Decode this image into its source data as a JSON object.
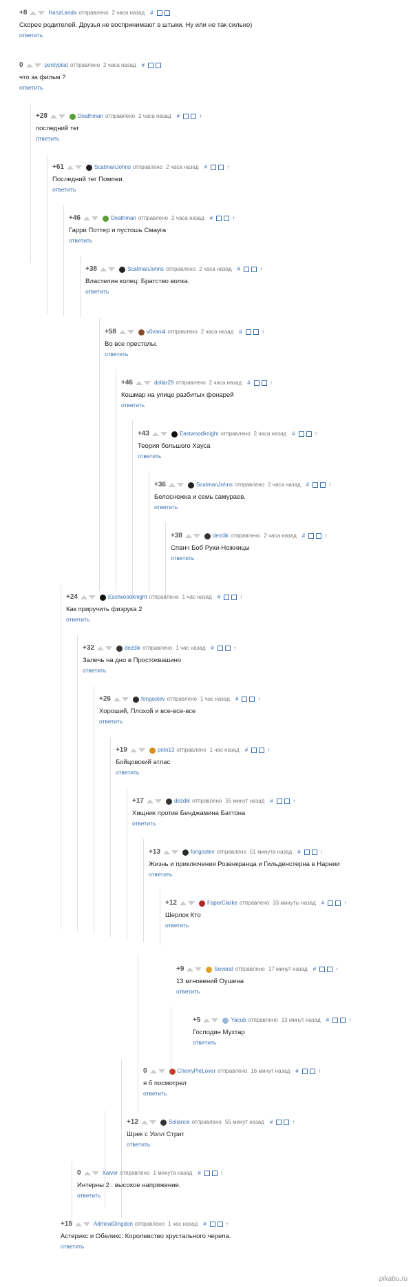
{
  "labels": {
    "sent": "отправлено",
    "reply": "ответить"
  },
  "colors": {
    "link": "#3a6fb0",
    "score": "#555555",
    "thread_line": "#e0e0e0"
  },
  "comments": [
    {
      "score": "+8",
      "user": "HanzLanda",
      "time": "2 часа назад",
      "text": "Скорее родителей. Друзья не воспринимают в штыки. Ну или не так сильно)",
      "avatar": null
    },
    {
      "score": "0",
      "user": "pontypilat",
      "time": "2 часа назад",
      "text": "что за фильм ?",
      "avatar": null
    },
    {
      "score": "+28",
      "user": "Deathman",
      "time": "2 часа назад",
      "text": "последний тег",
      "avatar": "#5a9e3a"
    },
    {
      "score": "+61",
      "user": "ScatmanJohns",
      "time": "2 часа назад",
      "text": "Последний тег Помпеи.",
      "avatar": "#222222"
    },
    {
      "score": "+46",
      "user": "Deathman",
      "time": "2 часа назад",
      "text": "Гарри Поттер и пустошь Смауга",
      "avatar": "#5a9e3a"
    },
    {
      "score": "+38",
      "user": "ScatmanJohns",
      "time": "2 часа назад",
      "text": "Властелин колец: Братство волка.",
      "avatar": "#222222"
    },
    {
      "score": "+58",
      "user": "v0vani4",
      "time": "2 часа назад",
      "text": "Во все престолы.",
      "avatar": "#8a4b2a"
    },
    {
      "score": "+46",
      "user": "dollar29",
      "time": "2 часа назад",
      "text": "Кошмар на улице разбитых фонарей",
      "avatar": null
    },
    {
      "score": "+43",
      "user": "Eastwoodknight",
      "time": "2 часа назад",
      "text": "Теория большого Хауса",
      "avatar": "#111111"
    },
    {
      "score": "+36",
      "user": "ScatmanJohns",
      "time": "2 часа назад",
      "text": "Белоснежка и семь самураев.",
      "avatar": "#222222"
    },
    {
      "score": "+38",
      "user": "dezdik",
      "time": "2 часа назад",
      "text": "Спанч Боб Руки-Ножницы",
      "avatar": "#333333"
    },
    {
      "score": "+24",
      "user": "Eastwoodknight",
      "time": "1 час назад",
      "text": "Как приручить физрука 2",
      "avatar": "#111111"
    },
    {
      "score": "+32",
      "user": "dezdik",
      "time": "1 час назад",
      "text": "Залечь на дно в Простоквашино",
      "avatar": "#333333"
    },
    {
      "score": "+26",
      "user": "fongostev",
      "time": "1 час назад",
      "text": "Хороший, Плохой и все-все-все",
      "avatar": "#2a2a2a"
    },
    {
      "score": "+19",
      "user": "pntn13",
      "time": "1 час назад",
      "text": "Бойцовский атлас",
      "avatar": "#d98c1a"
    },
    {
      "score": "+17",
      "user": "dezdik",
      "time": "55 минут назад",
      "text": "Хищник против Бенджамина Баттона",
      "avatar": "#333333"
    },
    {
      "score": "+13",
      "user": "fongostev",
      "time": "51 минута назад",
      "text": "Жизнь и приключения Розенкранца и Гильденстерна в Нарнии",
      "avatar": "#2a2a2a"
    },
    {
      "score": "+12",
      "user": "FaperClarke",
      "time": "33 минуты назад",
      "text": "Шерлок Кто",
      "avatar": "#b3262a"
    },
    {
      "score": "+9",
      "user": "Several",
      "time": "17 минут назад",
      "text": "13 мгновений Оушена",
      "avatar": "#e0a020"
    },
    {
      "score": "+5",
      "user": "Yacub",
      "time": "13 минут назад",
      "text": "Господин Мухтар",
      "avatar": "#9ab8d8"
    },
    {
      "score": "0",
      "user": "CherryPieLover",
      "time": "16 минут назад",
      "text": "я б посмотрел",
      "avatar": "#c2402a"
    },
    {
      "score": "+12",
      "user": "Soliance",
      "time": "55 минут назад",
      "text": "Шрек с Уолл Стрит",
      "avatar": "#333333"
    },
    {
      "score": "0",
      "user": "Xaiver",
      "time": "1 минута назад",
      "text": "Интерны 2 : высокое напряжение.",
      "avatar": null
    },
    {
      "score": "+15",
      "user": "AdmiralDingdon",
      "time": "1 час назад",
      "text": "Астерикс и Обеликс: Королевство хрустального черепа.",
      "avatar": null
    }
  ],
  "watermark": "pikabu.ru"
}
